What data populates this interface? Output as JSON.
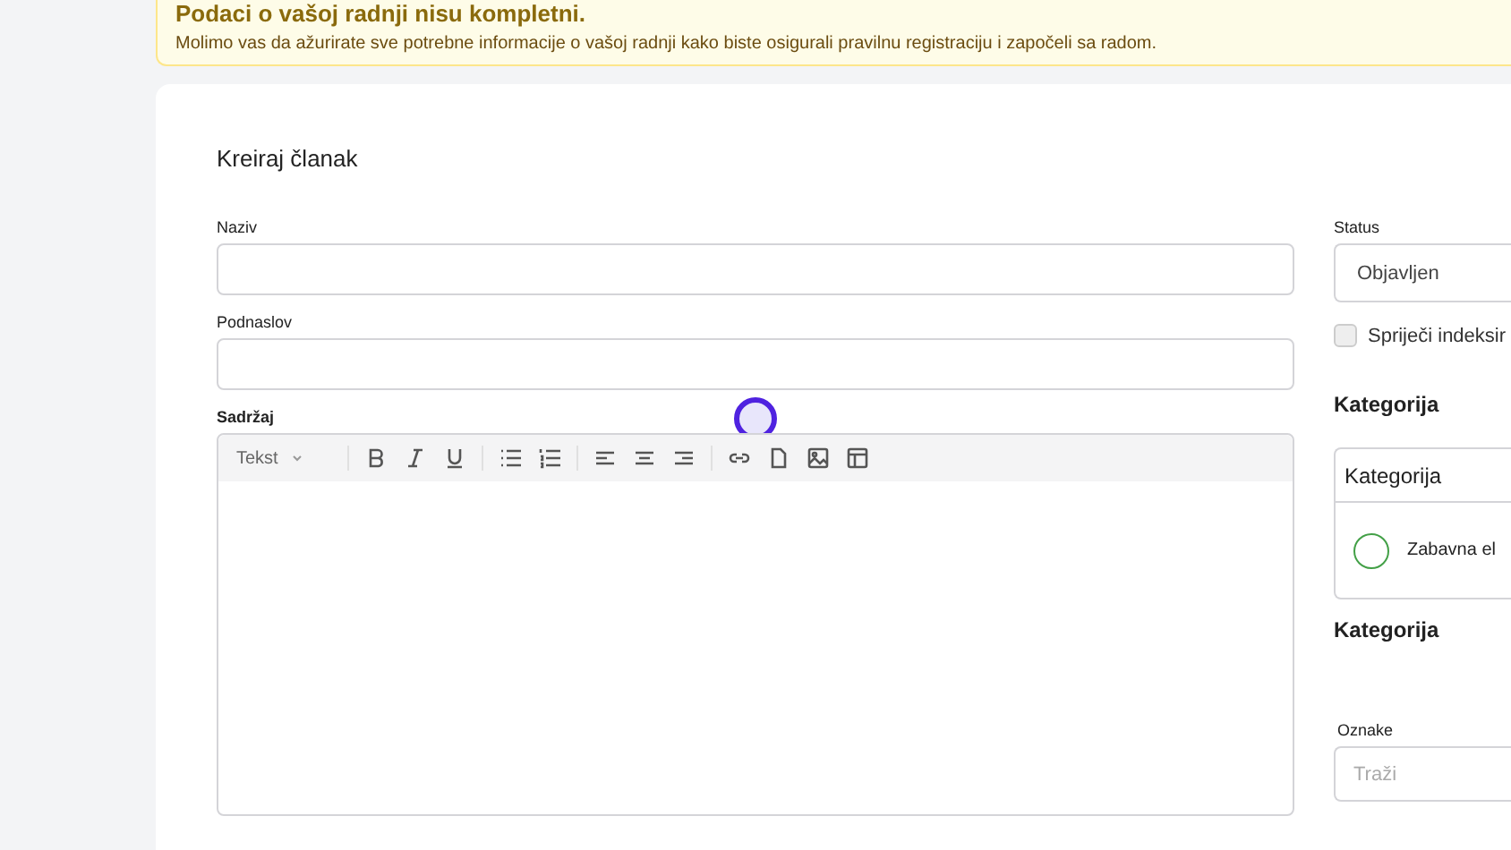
{
  "banner": {
    "title": "Podaci o vašoj radnji nisu kompletni.",
    "message": "Molimo vas da ažurirate sve potrebne informacije o vašoj radnji kako biste osigurali pravilnu registraciju i započeli sa radom."
  },
  "form": {
    "title": "Kreiraj članak",
    "fields": [
      {
        "label": "Naziv"
      },
      {
        "label": "Podnaslov"
      }
    ],
    "editor": {
      "label": "Sadržaj",
      "format_dropdown": "Tekst"
    }
  },
  "sidebar": {
    "status": {
      "label": "Status",
      "value": "Objavljen"
    },
    "noindex": {
      "label": "Spriječi indeksir",
      "checked": false
    },
    "category_heading": "Kategorija",
    "category_box": {
      "title": "Kategorija",
      "options": [
        {
          "label": "Zabavna el",
          "selected": false
        }
      ]
    },
    "category_heading_2": "Kategorija",
    "tags": {
      "label": "Oznake",
      "placeholder": "Traži"
    }
  }
}
